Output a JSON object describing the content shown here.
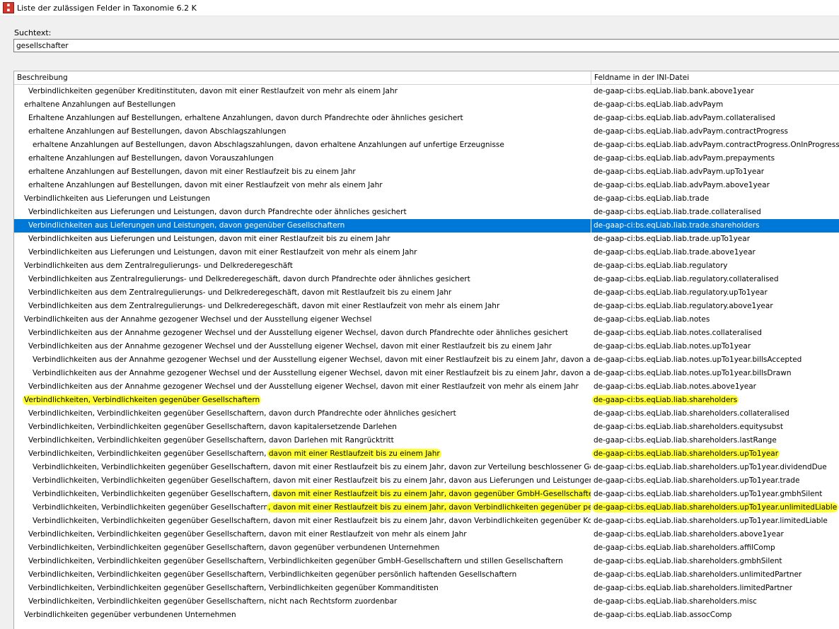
{
  "window": {
    "title": "Liste der zulässigen Felder in Taxonomie 6.2 K",
    "icon": "app-icon"
  },
  "search": {
    "label": "Suchtext:",
    "value": "gesellschafter"
  },
  "table": {
    "columns": [
      "Beschreibung",
      "Feldname in der INI-Datei"
    ],
    "rows": [
      {
        "indent": 2,
        "desc": "Verbindlichkeiten gegenüber Kreditinstituten, davon mit einer Restlaufzeit von mehr als einem Jahr",
        "field": "de-gaap-ci:bs.eqLiab.liab.bank.above1year"
      },
      {
        "indent": 1,
        "desc": "erhaltene Anzahlungen auf Bestellungen",
        "field": "de-gaap-ci:bs.eqLiab.liab.advPaym"
      },
      {
        "indent": 2,
        "desc": "Erhaltene Anzahlungen auf Bestellungen, erhaltene Anzahlungen, davon durch Pfandrechte oder ähnliches gesichert",
        "field": "de-gaap-ci:bs.eqLiab.liab.advPaym.collateralised"
      },
      {
        "indent": 2,
        "desc": "erhaltene Anzahlungen auf Bestellungen, davon Abschlagszahlungen",
        "field": "de-gaap-ci:bs.eqLiab.liab.advPaym.contractProgress"
      },
      {
        "indent": 3,
        "desc": "erhaltene Anzahlungen auf Bestellungen, davon Abschlagszahlungen, davon erhaltene Anzahlungen auf unfertige Erzeugnisse",
        "field": "de-gaap-ci:bs.eqLiab.liab.advPaym.contractProgress.OnInProgress"
      },
      {
        "indent": 2,
        "desc": "erhaltene Anzahlungen auf Bestellungen, davon Vorauszahlungen",
        "field": "de-gaap-ci:bs.eqLiab.liab.advPaym.prepayments"
      },
      {
        "indent": 2,
        "desc": "erhaltene Anzahlungen auf Bestellungen, davon mit einer Restlaufzeit bis zu einem Jahr",
        "field": "de-gaap-ci:bs.eqLiab.liab.advPaym.upTo1year"
      },
      {
        "indent": 2,
        "desc": "erhaltene Anzahlungen auf Bestellungen, davon mit einer Restlaufzeit von mehr als einem Jahr",
        "field": "de-gaap-ci:bs.eqLiab.liab.advPaym.above1year"
      },
      {
        "indent": 1,
        "desc": "Verbindlichkeiten aus Lieferungen und Leistungen",
        "field": "de-gaap-ci:bs.eqLiab.liab.trade"
      },
      {
        "indent": 2,
        "desc": "Verbindlichkeiten aus Lieferungen und Leistungen, davon durch Pfandrechte oder ähnliches gesichert",
        "field": "de-gaap-ci:bs.eqLiab.liab.trade.collateralised"
      },
      {
        "indent": 2,
        "desc": "Verbindlichkeiten aus Lieferungen und Leistungen, davon gegenüber Gesellschaftern",
        "field": "de-gaap-ci:bs.eqLiab.liab.trade.shareholders",
        "selected": true
      },
      {
        "indent": 2,
        "desc": "Verbindlichkeiten aus Lieferungen und Leistungen, davon mit einer Restlaufzeit bis zu einem Jahr",
        "field": "de-gaap-ci:bs.eqLiab.liab.trade.upTo1year"
      },
      {
        "indent": 2,
        "desc": "Verbindlichkeiten aus Lieferungen und Leistungen, davon mit einer Restlaufzeit von mehr als einem Jahr",
        "field": "de-gaap-ci:bs.eqLiab.liab.trade.above1year"
      },
      {
        "indent": 1,
        "desc": "Verbindlichkeiten aus dem Zentralregulierungs- und Delkrederegeschäft",
        "field": "de-gaap-ci:bs.eqLiab.liab.regulatory"
      },
      {
        "indent": 2,
        "desc": "Verbindlichkeiten aus Zentralregulierungs- und Delkrederegeschäft, davon durch Pfandrechte oder ähnliches gesichert",
        "field": "de-gaap-ci:bs.eqLiab.liab.regulatory.collateralised"
      },
      {
        "indent": 2,
        "desc": "Verbindlichkeiten aus dem Zentralregulierungs- und Delkrederegeschäft, davon mit Restlaufzeit bis zu einem Jahr",
        "field": "de-gaap-ci:bs.eqLiab.liab.regulatory.upTo1year"
      },
      {
        "indent": 2,
        "desc": "Verbindlichkeiten aus dem Zentralregulierungs- und Delkrederegeschäft, davon mit einer Restlaufzeit von mehr als einem Jahr",
        "field": "de-gaap-ci:bs.eqLiab.liab.regulatory.above1year"
      },
      {
        "indent": 1,
        "desc": "Verbindlichkeiten aus der Annahme gezogener Wechsel und der Ausstellung eigener Wechsel",
        "field": "de-gaap-ci:bs.eqLiab.liab.notes"
      },
      {
        "indent": 2,
        "desc": "Verbindlichkeiten aus der Annahme gezogener Wechsel und der Ausstellung eigener Wechsel, davon durch Pfandrechte oder ähnliches gesichert",
        "field": "de-gaap-ci:bs.eqLiab.liab.notes.collateralised"
      },
      {
        "indent": 2,
        "desc": "Verbindlichkeiten aus der Annahme gezogener Wechsel und der Ausstellung eigener Wechsel, davon mit einer Restlaufzeit bis zu einem Jahr",
        "field": "de-gaap-ci:bs.eqLiab.liab.notes.upTo1year"
      },
      {
        "indent": 3,
        "desc": "Verbindlichkeiten aus der Annahme gezogener Wechsel und der Ausstellung eigener Wechsel, davon mit einer Restlaufzeit bis zu einem Jahr, davon aus der Annahme gezogener Wechsel",
        "field": "de-gaap-ci:bs.eqLiab.liab.notes.upTo1year.billsAccepted"
      },
      {
        "indent": 3,
        "desc": "Verbindlichkeiten aus der Annahme gezogener Wechsel und der Ausstellung eigener Wechsel, davon mit einer Restlaufzeit bis zu einem Jahr, davon aus der Ausstellung eigener Wechsel",
        "field": "de-gaap-ci:bs.eqLiab.liab.notes.upTo1year.billsDrawn"
      },
      {
        "indent": 2,
        "desc": "Verbindlichkeiten aus der Annahme gezogener Wechsel und der Ausstellung eigener Wechsel, davon mit einer Restlaufzeit von mehr als einem Jahr",
        "field": "de-gaap-ci:bs.eqLiab.liab.notes.above1year"
      },
      {
        "indent": 1,
        "desc": "",
        "desc_hl": "Verbindlichkeiten, Verbindlichkeiten gegenüber Gesellschaftern",
        "field": "",
        "field_hl": "de-gaap-ci:bs.eqLiab.liab.shareholders"
      },
      {
        "indent": 2,
        "desc": "Verbindlichkeiten, Verbindlichkeiten gegenüber Gesellschaftern, davon durch Pfandrechte oder ähnliches gesichert",
        "field": "de-gaap-ci:bs.eqLiab.liab.shareholders.collateralised"
      },
      {
        "indent": 2,
        "desc": "Verbindlichkeiten, Verbindlichkeiten gegenüber Gesellschaftern, davon kapitalersetzende Darlehen",
        "field": "de-gaap-ci:bs.eqLiab.liab.shareholders.equitysubst"
      },
      {
        "indent": 2,
        "desc": "Verbindlichkeiten, Verbindlichkeiten gegenüber Gesellschaftern, davon Darlehen mit Rangrücktritt",
        "field": "de-gaap-ci:bs.eqLiab.liab.shareholders.lastRange"
      },
      {
        "indent": 2,
        "desc": "Verbindlichkeiten, Verbindlichkeiten gegenüber Gesellschaftern, ",
        "desc_hl": "davon mit einer Restlaufzeit bis zu einem Jahr",
        "field": "",
        "field_hl": "de-gaap-ci:bs.eqLiab.liab.shareholders.upTo1year"
      },
      {
        "indent": 3,
        "desc": "Verbindlichkeiten, Verbindlichkeiten gegenüber Gesellschaftern, davon mit einer Restlaufzeit bis zu einem Jahr, davon zur Verteilung beschlossener Gewinn bzw. Dividende",
        "field": "de-gaap-ci:bs.eqLiab.liab.shareholders.upTo1year.dividendDue"
      },
      {
        "indent": 3,
        "desc": "Verbindlichkeiten, Verbindlichkeiten gegenüber Gesellschaftern, davon mit einer Restlaufzeit bis zu einem Jahr, davon aus Lieferungen und Leistungen",
        "field": "de-gaap-ci:bs.eqLiab.liab.shareholders.upTo1year.trade"
      },
      {
        "indent": 3,
        "desc": "Verbindlichkeiten, Verbindlichkeiten gegenüber Gesellschaftern, ",
        "desc_hl": "davon mit einer Restlaufzeit bis zu einem Jahr, davon gegenüber GmbH-Gesellschaftern und stillen Gesellschaftern",
        "field": "de-gaap-ci:bs.eqLiab.liab.shareholders.upTo1year.gmbhSilent"
      },
      {
        "indent": 3,
        "desc": "Verbindlichkeiten, Verbindlichkeiten gegenüber Gesellschaftern",
        "desc_hl": ", davon mit einer Restlaufzeit bis zu einem Jahr, davon Verbindlichkeiten gegenüber persönlich haftenden Gesellschaftern",
        "field": "",
        "field_hl": "de-gaap-ci:bs.eqLiab.liab.shareholders.upTo1year.unlimitedLiable"
      },
      {
        "indent": 3,
        "desc": "Verbindlichkeiten, Verbindlichkeiten gegenüber Gesellschaftern, davon mit einer Restlaufzeit bis zu einem Jahr, davon Verbindlichkeiten gegenüber Kommanditisten",
        "field": "de-gaap-ci:bs.eqLiab.liab.shareholders.upTo1year.limitedLiable"
      },
      {
        "indent": 2,
        "desc": "Verbindlichkeiten, Verbindlichkeiten gegenüber Gesellschaftern, davon mit einer Restlaufzeit von mehr als einem Jahr",
        "field": "de-gaap-ci:bs.eqLiab.liab.shareholders.above1year"
      },
      {
        "indent": 2,
        "desc": "Verbindlichkeiten, Verbindlichkeiten gegenüber Gesellschaftern, davon gegenüber verbundenen Unternehmen",
        "field": "de-gaap-ci:bs.eqLiab.liab.shareholders.affilComp"
      },
      {
        "indent": 2,
        "desc": "Verbindlichkeiten, Verbindlichkeiten gegenüber Gesellschaftern, Verbindlichkeiten gegenüber GmbH-Gesellschaftern und stillen Gesellschaftern",
        "field": "de-gaap-ci:bs.eqLiab.liab.shareholders.gmbhSilent"
      },
      {
        "indent": 2,
        "desc": "Verbindlichkeiten, Verbindlichkeiten gegenüber Gesellschaftern, Verbindlichkeiten gegenüber persönlich haftenden Gesellschaftern",
        "field": "de-gaap-ci:bs.eqLiab.liab.shareholders.unlimitedPartner"
      },
      {
        "indent": 2,
        "desc": "Verbindlichkeiten, Verbindlichkeiten gegenüber Gesellschaftern, Verbindlichkeiten gegenüber Kommanditisten",
        "field": "de-gaap-ci:bs.eqLiab.liab.shareholders.limitedPartner"
      },
      {
        "indent": 2,
        "desc": "Verbindlichkeiten, Verbindlichkeiten gegenüber Gesellschaftern, nicht nach Rechtsform zuordenbar",
        "field": "de-gaap-ci:bs.eqLiab.liab.shareholders.misc"
      },
      {
        "indent": 1,
        "desc": "Verbindlichkeiten gegenüber verbundenen Unternehmen",
        "field": "de-gaap-ci:bs.eqLiab.liab.assocComp"
      }
    ]
  },
  "colors": {
    "selection": "#0078d7",
    "highlight": "#ffff33"
  }
}
